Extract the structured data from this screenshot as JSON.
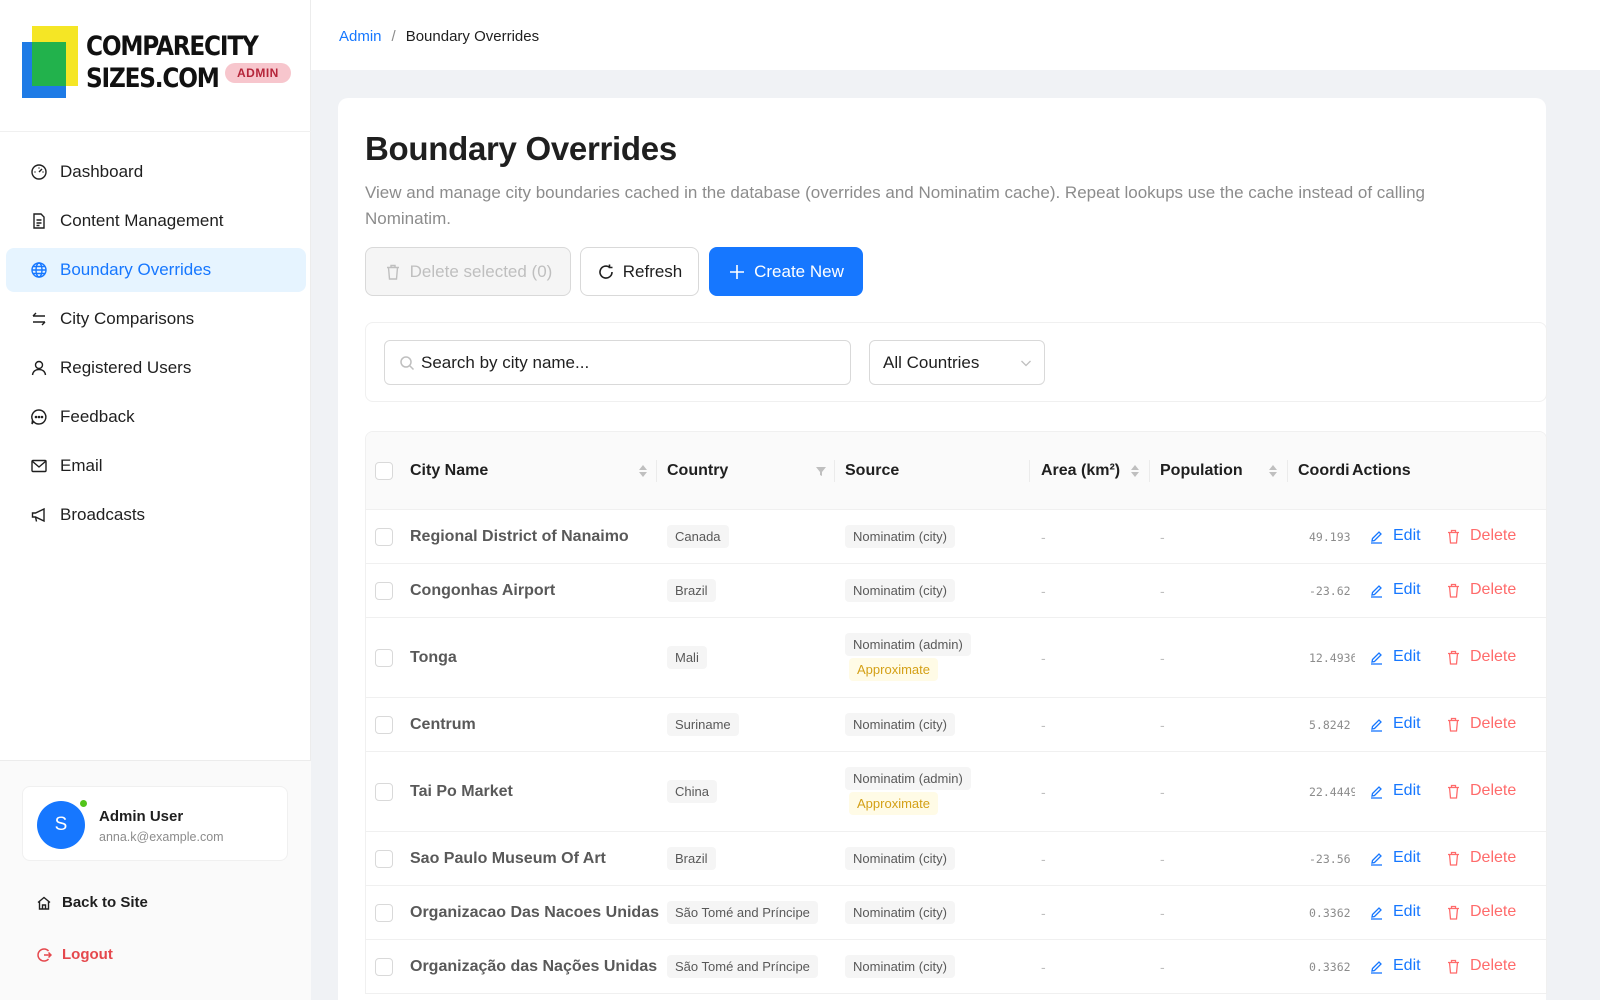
{
  "brand": {
    "line1": "COMPARECITY",
    "line2": "SIZES.COM",
    "badge": "ADMIN",
    "colors": {
      "blue": "#1e7be6",
      "yellow": "#f5e625",
      "green": "#22b24c"
    }
  },
  "sidebar": {
    "items": [
      {
        "label": "Dashboard",
        "icon": "dashboard-icon",
        "active": false
      },
      {
        "label": "Content Management",
        "icon": "document-icon",
        "active": false
      },
      {
        "label": "Boundary Overrides",
        "icon": "globe-icon",
        "active": true
      },
      {
        "label": "City Comparisons",
        "icon": "swap-icon",
        "active": false
      },
      {
        "label": "Registered Users",
        "icon": "user-icon",
        "active": false
      },
      {
        "label": "Feedback",
        "icon": "chat-icon",
        "active": false
      },
      {
        "label": "Email",
        "icon": "mail-icon",
        "active": false
      },
      {
        "label": "Broadcasts",
        "icon": "megaphone-icon",
        "active": false
      }
    ],
    "user": {
      "initial": "S",
      "name": "Admin User",
      "email": "anna.k@example.com"
    },
    "back_to_site": "Back to Site",
    "logout": "Logout"
  },
  "breadcrumb": {
    "root": "Admin",
    "separator": "/",
    "current": "Boundary Overrides"
  },
  "page": {
    "title": "Boundary Overrides",
    "description": "View and manage city boundaries cached in the database (overrides and Nominatim cache). Repeat lookups use the cache instead of calling Nominatim."
  },
  "toolbar": {
    "delete_selected": "Delete selected (0)",
    "refresh": "Refresh",
    "create_new": "Create New"
  },
  "filters": {
    "search_placeholder": "Search by city name...",
    "country_selected": "All Countries"
  },
  "table": {
    "columns": {
      "city": "City Name",
      "country": "Country",
      "source": "Source",
      "area": "Area (km²)",
      "population": "Population",
      "coords": "Coordi",
      "actions": "Actions"
    },
    "edit_label": "Edit",
    "delete_label": "Delete",
    "rows": [
      {
        "city": "Regional District of Nanaimo",
        "country": "Canada",
        "source": "Nominatim (city)",
        "approx": "",
        "area": "-",
        "population": "-",
        "coords": "49.193"
      },
      {
        "city": "Congonhas Airport",
        "country": "Brazil",
        "source": "Nominatim (city)",
        "approx": "",
        "area": "-",
        "population": "-",
        "coords": "-23.62"
      },
      {
        "city": "Tonga",
        "country": "Mali",
        "source": "Nominatim (admin)",
        "approx": "Approximate",
        "area": "-",
        "population": "-",
        "coords": "12.4936"
      },
      {
        "city": "Centrum",
        "country": "Suriname",
        "source": "Nominatim (city)",
        "approx": "",
        "area": "-",
        "population": "-",
        "coords": "5.8242"
      },
      {
        "city": "Tai Po Market",
        "country": "China",
        "source": "Nominatim (admin)",
        "approx": "Approximate",
        "area": "-",
        "population": "-",
        "coords": "22.4449"
      },
      {
        "city": "Sao Paulo Museum Of Art",
        "country": "Brazil",
        "source": "Nominatim (city)",
        "approx": "",
        "area": "-",
        "population": "-",
        "coords": "-23.56"
      },
      {
        "city": "Organizacao Das Nacoes Unidas",
        "country": "São Tomé and Príncipe",
        "source": "Nominatim (city)",
        "approx": "",
        "area": "-",
        "population": "-",
        "coords": "0.3362"
      },
      {
        "city": "Organização das Nações Unidas",
        "country": "São Tomé and Príncipe",
        "source": "Nominatim (city)",
        "approx": "",
        "area": "-",
        "population": "-",
        "coords": "0.3362"
      }
    ]
  },
  "colors": {
    "primary": "#1677ff",
    "danger": "#ff6b6b",
    "warning": "#d4a017",
    "online": "#52c41a"
  }
}
